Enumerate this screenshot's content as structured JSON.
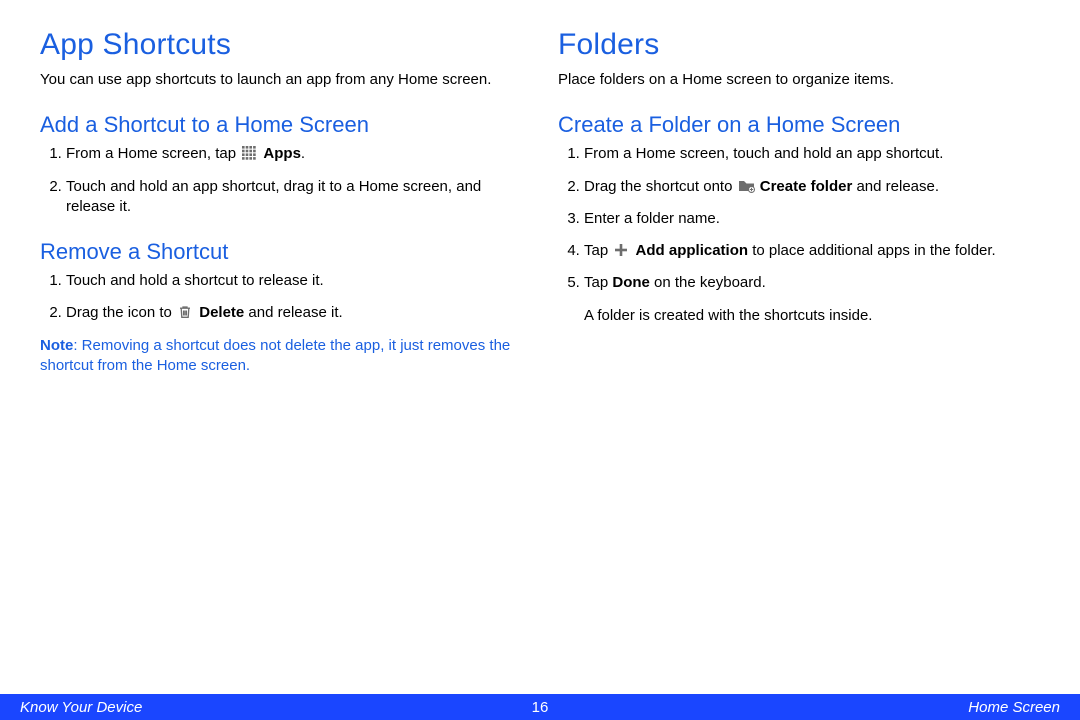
{
  "left": {
    "h1": "App Shortcuts",
    "intro": "You can use app shortcuts to launch an app from any Home screen.",
    "h2a": "Add a Shortcut to a Home Screen",
    "add1_pre": "From a Home screen, tap ",
    "add1_bold": "Apps",
    "add1_post": ".",
    "add2": "Touch and hold an app shortcut, drag it to a Home screen, and release it.",
    "h2b": "Remove a Shortcut",
    "rem1": "Touch and hold a shortcut to release it.",
    "rem2_pre": "Drag the icon to ",
    "rem2_bold": "Delete",
    "rem2_post": " and release it.",
    "note_label": "Note",
    "note_body": ": Removing a shortcut does not delete the app, it just removes the shortcut from the Home screen."
  },
  "right": {
    "h1": "Folders",
    "intro": "Place folders on a Home screen to organize items.",
    "h2": "Create a Folder on a Home Screen",
    "s1": "From a Home screen, touch and hold an app shortcut.",
    "s2_pre": "Drag the shortcut onto ",
    "s2_bold": "Create folder",
    "s2_post": " and release.",
    "s3": "Enter a folder name.",
    "s4_pre": "Tap ",
    "s4_bold": "Add application",
    "s4_post": " to place additional apps in the folder.",
    "s5_pre": "Tap ",
    "s5_bold": "Done",
    "s5_post": " on the keyboard.",
    "tail": "A folder is created with the shortcuts inside."
  },
  "footer": {
    "left": "Know Your Device",
    "page": "16",
    "right": "Home Screen"
  }
}
